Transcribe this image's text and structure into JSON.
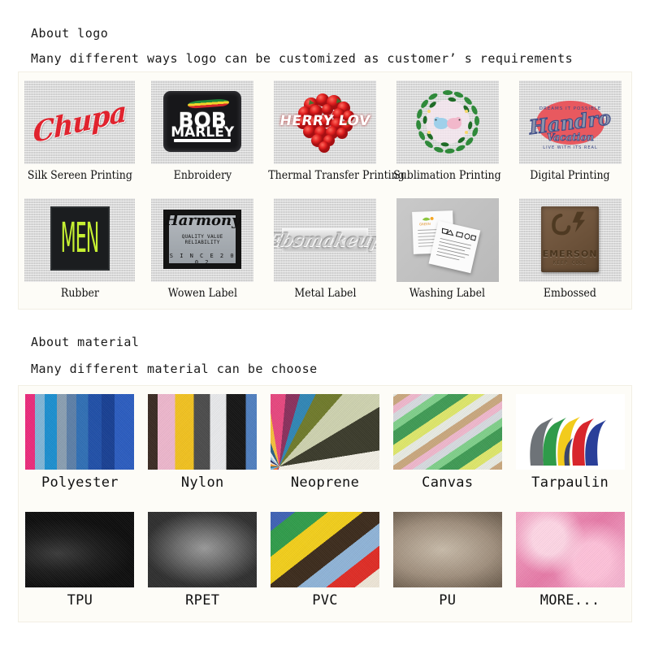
{
  "logo_section": {
    "heading": "About logo",
    "subheading": "Many different ways logo can be customized as customer’ s requirements",
    "items": [
      {
        "caption": "Silk Sereen Printing",
        "image": "chupa-red-script-logo-on-gray-fabric"
      },
      {
        "caption": "Enbroidery",
        "image": "bob-marley-black-embroidered-patch"
      },
      {
        "caption": "Thermal Transfer Printing",
        "image": "strawberry-heart-herry-lov-print"
      },
      {
        "caption": "Sublimation Printing",
        "image": "green-laurel-wreath-with-two-birds"
      },
      {
        "caption": "Digital Printing",
        "image": "handroo-vacation-vintage-script-logo"
      },
      {
        "caption": "Rubber",
        "image": "black-rubber-patch-neon-men"
      },
      {
        "caption": "Wowen Label",
        "image": "harmony-woven-label"
      },
      {
        "caption": "Metal Label",
        "image": "ebsmakeup-silver-metal-label"
      },
      {
        "caption": "Washing Label",
        "image": "white-care-wash-labels"
      },
      {
        "caption": "Embossed",
        "image": "brown-embossed-leather-patch-emerson"
      }
    ],
    "artwork": {
      "chupa_text": "Chupa",
      "bob_line1": "BOB",
      "bob_line2": "MARLEY",
      "heart_text": "HERRY LOV",
      "men_text": "MEN",
      "woven_brand": "Harmony",
      "woven_tagline": "QUALITY VALUE RELIABILITY",
      "woven_since": "S I N C E   2 0 0 2",
      "metal_text": "Ebsmakeup",
      "embossed_name": "EMERSON",
      "embossed_sub": "KEEP COOL"
    }
  },
  "material_section": {
    "heading": "About material",
    "subheading": "Many different material can be choose",
    "items": [
      {
        "caption": "Polyester",
        "image": "polyester-vertical-color-stripes"
      },
      {
        "caption": "Nylon",
        "image": "nylon-vertical-color-stripes"
      },
      {
        "caption": "Neoprene",
        "image": "neoprene-fanned-diagonal-stripes"
      },
      {
        "caption": "Canvas",
        "image": "canvas-diagonal-green-bands"
      },
      {
        "caption": "Tarpaulin",
        "image": "tarpaulin-rolled-color-tubes"
      },
      {
        "caption": "TPU",
        "image": "tpu-black-glossy-film"
      },
      {
        "caption": "RPET",
        "image": "rpet-gray-swirled-fabric"
      },
      {
        "caption": "PVC",
        "image": "pvc-diagonal-color-layers"
      },
      {
        "caption": "PU",
        "image": "pu-beige-leather-texture"
      },
      {
        "caption": "MORE...",
        "image": "pink-plush-fur-fabric"
      }
    ]
  },
  "colors": {
    "panel_background": "#fdfcf7",
    "page_background": "#ffffff",
    "text": "#1a1a1a",
    "chupa_red": "#e0232e",
    "neon_green": "#c6f032",
    "leather_brown": "#6b5139"
  }
}
